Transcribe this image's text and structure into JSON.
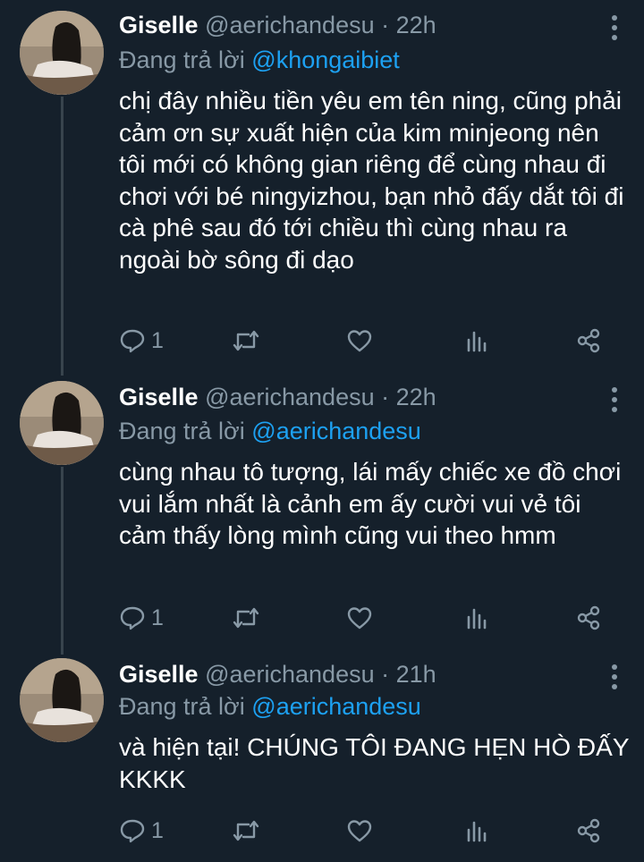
{
  "tweets": [
    {
      "name": "Giselle",
      "handle": "@aerichandesu",
      "separator": "·",
      "time": "22h",
      "reply_prefix": "Đang trả lời",
      "reply_to": "@khongaibiet",
      "text": "chị đây nhiều tiền yêu em tên ning, cũng phải cảm ơn sự xuất hiện của kim minjeong nên tôi mới có không gian riêng để cùng nhau đi chơi với bé ningyizhou, bạn nhỏ đấy dắt tôi đi cà phê sau đó tới chiều thì cùng nhau ra ngoài bờ sông đi dạo",
      "reply_count": "1"
    },
    {
      "name": "Giselle",
      "handle": "@aerichandesu",
      "separator": "·",
      "time": "22h",
      "reply_prefix": "Đang trả lời",
      "reply_to": "@aerichandesu",
      "text": "cùng nhau tô tượng, lái mấy chiếc xe đồ chơi vui lắm nhất là cảnh em ấy cười vui vẻ tôi cảm thấy lòng mình cũng vui theo hmm",
      "reply_count": "1"
    },
    {
      "name": "Giselle",
      "handle": "@aerichandesu",
      "separator": "·",
      "time": "21h",
      "reply_prefix": "Đang trả lời",
      "reply_to": "@aerichandesu",
      "text": "và hiện tại! CHÚNG TÔI ĐANG HẸN HÒ ĐẤY KKKK",
      "reply_count": "1"
    }
  ],
  "icons": {
    "reply": "reply-icon",
    "retweet": "retweet-icon",
    "like": "heart-icon",
    "analytics": "analytics-icon",
    "share": "share-icon",
    "more": "more-vertical-icon"
  },
  "colors": {
    "background": "#15202b",
    "text": "#ffffff",
    "secondary": "#8899a6",
    "link": "#1da1f2",
    "thread_line": "#38444d"
  }
}
